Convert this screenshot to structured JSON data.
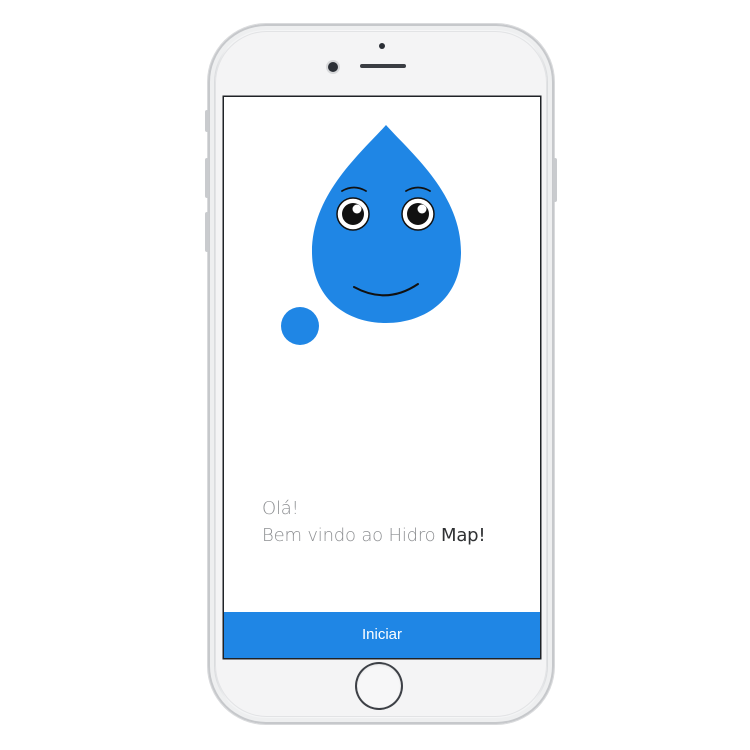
{
  "colors": {
    "accent": "#1f86e5",
    "screen_background": "#ffffff",
    "greeting_text": "#8d8f92",
    "brand_text": "#2f3133"
  },
  "illustration": {
    "name": "water-drop-mascot",
    "elements": [
      "water-drop",
      "eyes",
      "eyebrows",
      "smile",
      "small-bubble"
    ]
  },
  "welcome": {
    "line1": "Olá!",
    "line2_prefix": "Bem vindo ao Hidro",
    "line2_brand": "Map!"
  },
  "start_button": {
    "label": "Iniciar"
  }
}
